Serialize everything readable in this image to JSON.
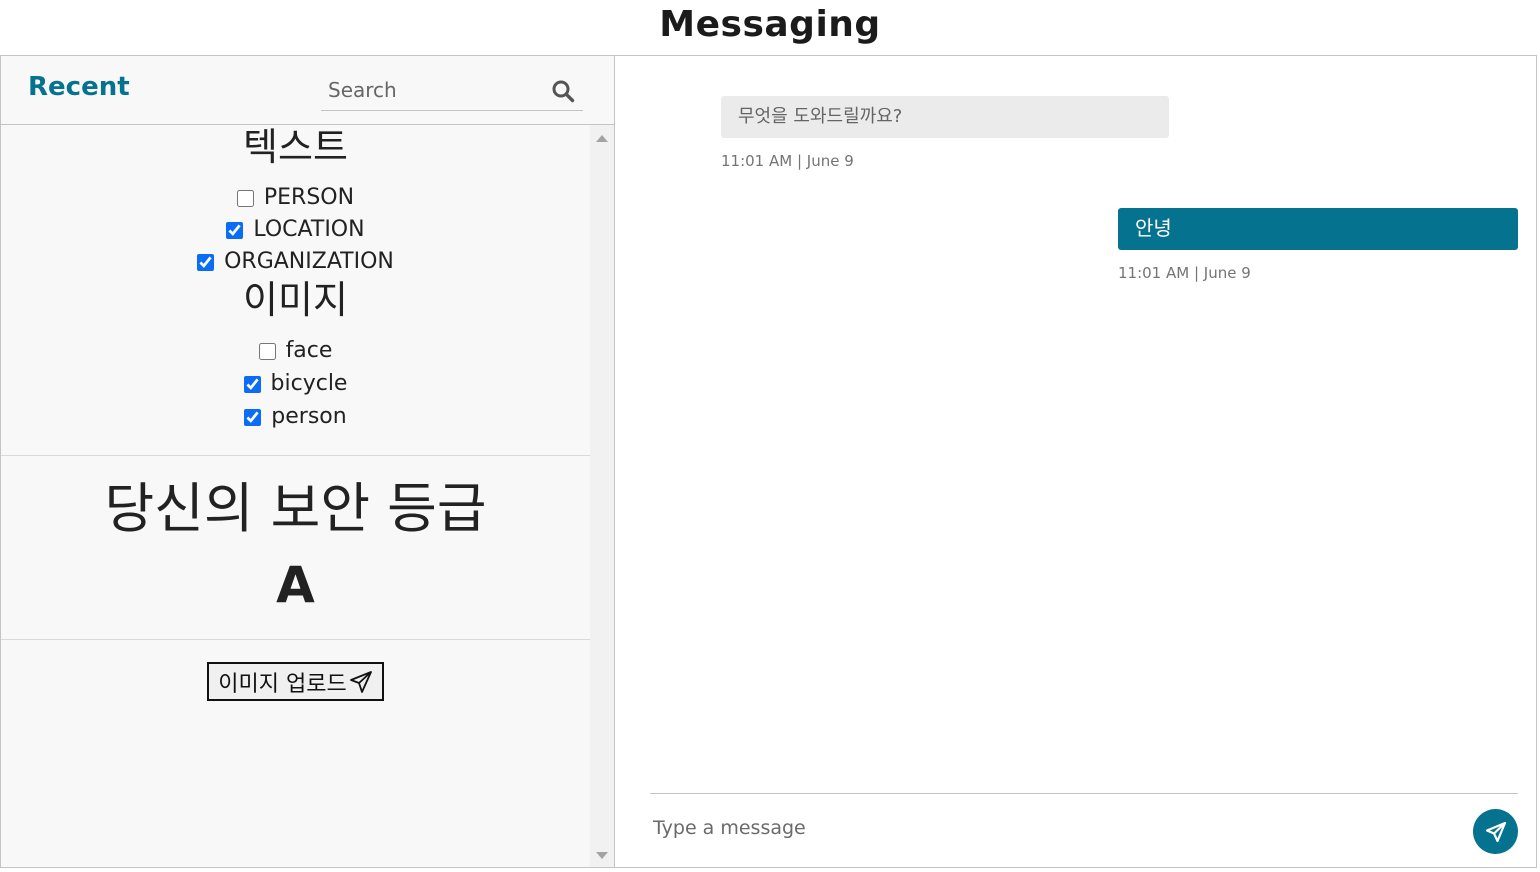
{
  "page": {
    "title": "Messaging"
  },
  "sidebar": {
    "recent_label": "Recent",
    "search": {
      "placeholder": "Search",
      "value": ""
    },
    "filters": {
      "text_heading": "텍스트",
      "text_options": [
        {
          "label": "PERSON",
          "checked": false
        },
        {
          "label": "LOCATION",
          "checked": true
        },
        {
          "label": "ORGANIZATION",
          "checked": true
        }
      ],
      "image_heading": "이미지",
      "image_options": [
        {
          "label": "face",
          "checked": false
        },
        {
          "label": "bicycle",
          "checked": true
        },
        {
          "label": "person",
          "checked": true
        }
      ]
    },
    "security": {
      "label": "당신의 보안 등급",
      "grade": "A"
    },
    "upload_label": "이미지 업로드"
  },
  "chat": {
    "messages": [
      {
        "direction": "incoming",
        "text": "무엇을 도와드릴까요?",
        "time": "11:01 AM | June 9"
      },
      {
        "direction": "outgoing",
        "text": "안녕",
        "time": "11:01 AM | June 9"
      }
    ],
    "composer": {
      "placeholder": "Type a message",
      "value": ""
    }
  },
  "colors": {
    "accent": "#05728f",
    "incoming_bubble": "#ebebeb",
    "sidebar_bg": "#f8f8f8",
    "checkbox": "#0b6cf5"
  },
  "icons": {
    "search": "search-icon",
    "send": "paper-plane-icon",
    "upload": "paper-plane-icon"
  }
}
